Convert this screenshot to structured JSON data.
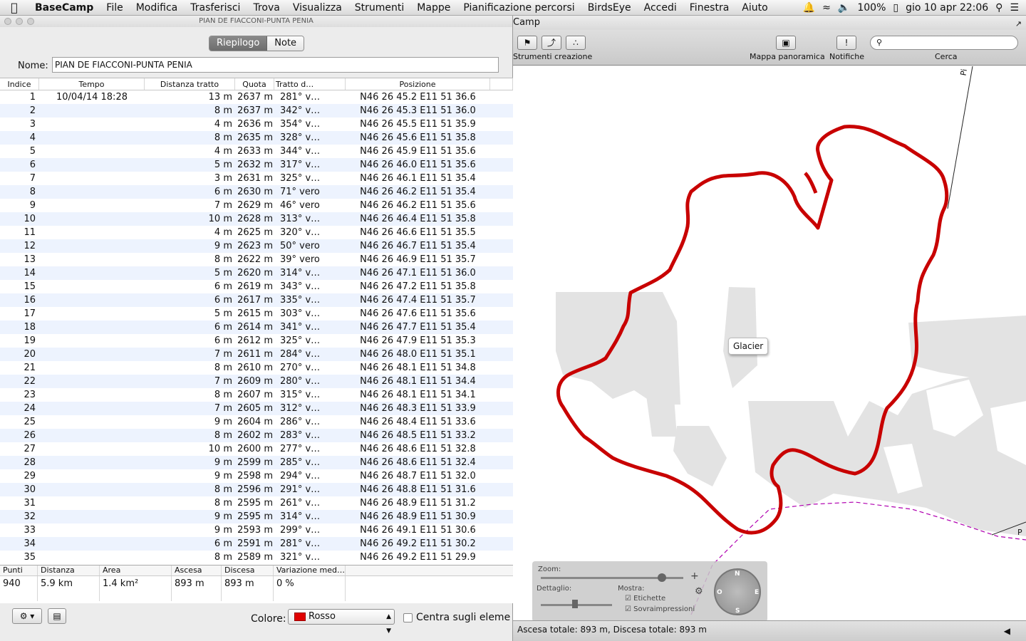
{
  "menubar": {
    "app": "BaseCamp",
    "items": [
      "File",
      "Modifica",
      "Trasferisci",
      "Trova",
      "Visualizza",
      "Strumenti",
      "Mappe",
      "Pianificazione percorsi",
      "BirdsEye",
      "Accedi",
      "Finestra",
      "Aiuto"
    ],
    "battery": "100%",
    "clock": "gio 10 apr  22:06"
  },
  "track_window": {
    "title": "PIAN DE FIACCONI-PUNTA PENIA",
    "tabs": [
      "Riepilogo",
      "Note"
    ],
    "nome_label": "Nome:",
    "nome_value": "PIAN DE FIACCONI-PUNTA PENIA",
    "columns": [
      "Indice",
      "Tempo",
      "Distanza tratto",
      "Quota",
      "Tratto d…",
      "Posizione"
    ],
    "rows": [
      [
        "1",
        "10/04/14 18:28",
        "13 m",
        "2637 m",
        "281° v…",
        "N46 26 45.2 E11 51 36.6"
      ],
      [
        "2",
        "",
        "8 m",
        "2637 m",
        "342° v…",
        "N46 26 45.3 E11 51 36.0"
      ],
      [
        "3",
        "",
        "4 m",
        "2636 m",
        "354° v…",
        "N46 26 45.5 E11 51 35.9"
      ],
      [
        "4",
        "",
        "8 m",
        "2635 m",
        "328° v…",
        "N46 26 45.6 E11 51 35.8"
      ],
      [
        "5",
        "",
        "4 m",
        "2633 m",
        "344° v…",
        "N46 26 45.9 E11 51 35.6"
      ],
      [
        "6",
        "",
        "5 m",
        "2632 m",
        "317° v…",
        "N46 26 46.0 E11 51 35.6"
      ],
      [
        "7",
        "",
        "3 m",
        "2631 m",
        "325° v…",
        "N46 26 46.1 E11 51 35.4"
      ],
      [
        "8",
        "",
        "6 m",
        "2630 m",
        "71° vero",
        "N46 26 46.2 E11 51 35.4"
      ],
      [
        "9",
        "",
        "7 m",
        "2629 m",
        "46° vero",
        "N46 26 46.2 E11 51 35.6"
      ],
      [
        "10",
        "",
        "10 m",
        "2628 m",
        "313° v…",
        "N46 26 46.4 E11 51 35.8"
      ],
      [
        "11",
        "",
        "4 m",
        "2625 m",
        "320° v…",
        "N46 26 46.6 E11 51 35.5"
      ],
      [
        "12",
        "",
        "9 m",
        "2623 m",
        "50° vero",
        "N46 26 46.7 E11 51 35.4"
      ],
      [
        "13",
        "",
        "8 m",
        "2622 m",
        "39° vero",
        "N46 26 46.9 E11 51 35.7"
      ],
      [
        "14",
        "",
        "5 m",
        "2620 m",
        "314° v…",
        "N46 26 47.1 E11 51 36.0"
      ],
      [
        "15",
        "",
        "6 m",
        "2619 m",
        "343° v…",
        "N46 26 47.2 E11 51 35.8"
      ],
      [
        "16",
        "",
        "6 m",
        "2617 m",
        "335° v…",
        "N46 26 47.4 E11 51 35.7"
      ],
      [
        "17",
        "",
        "5 m",
        "2615 m",
        "303° v…",
        "N46 26 47.6 E11 51 35.6"
      ],
      [
        "18",
        "",
        "6 m",
        "2614 m",
        "341° v…",
        "N46 26 47.7 E11 51 35.4"
      ],
      [
        "19",
        "",
        "6 m",
        "2612 m",
        "325° v…",
        "N46 26 47.9 E11 51 35.3"
      ],
      [
        "20",
        "",
        "7 m",
        "2611 m",
        "284° v…",
        "N46 26 48.0 E11 51 35.1"
      ],
      [
        "21",
        "",
        "8 m",
        "2610 m",
        "270° v…",
        "N46 26 48.1 E11 51 34.8"
      ],
      [
        "22",
        "",
        "7 m",
        "2609 m",
        "280° v…",
        "N46 26 48.1 E11 51 34.4"
      ],
      [
        "23",
        "",
        "8 m",
        "2607 m",
        "315° v…",
        "N46 26 48.1 E11 51 34.1"
      ],
      [
        "24",
        "",
        "7 m",
        "2605 m",
        "312° v…",
        "N46 26 48.3 E11 51 33.9"
      ],
      [
        "25",
        "",
        "9 m",
        "2604 m",
        "286° v…",
        "N46 26 48.4 E11 51 33.6"
      ],
      [
        "26",
        "",
        "8 m",
        "2602 m",
        "283° v…",
        "N46 26 48.5 E11 51 33.2"
      ],
      [
        "27",
        "",
        "10 m",
        "2600 m",
        "277° v…",
        "N46 26 48.6 E11 51 32.8"
      ],
      [
        "28",
        "",
        "9 m",
        "2599 m",
        "285° v…",
        "N46 26 48.6 E11 51 32.4"
      ],
      [
        "29",
        "",
        "9 m",
        "2598 m",
        "294° v…",
        "N46 26 48.7 E11 51 32.0"
      ],
      [
        "30",
        "",
        "8 m",
        "2596 m",
        "291° v…",
        "N46 26 48.8 E11 51 31.6"
      ],
      [
        "31",
        "",
        "8 m",
        "2595 m",
        "261° v…",
        "N46 26 48.9 E11 51 31.2"
      ],
      [
        "32",
        "",
        "9 m",
        "2595 m",
        "314° v…",
        "N46 26 48.9 E11 51 30.9"
      ],
      [
        "33",
        "",
        "9 m",
        "2593 m",
        "299° v…",
        "N46 26 49.1 E11 51 30.6"
      ],
      [
        "34",
        "",
        "6 m",
        "2591 m",
        "281° v…",
        "N46 26 49.2 E11 51 30.2"
      ],
      [
        "35",
        "",
        "8 m",
        "2589 m",
        "321° v…",
        "N46 26 49.2 E11 51 29.9"
      ]
    ],
    "summary_headers": [
      "Punti",
      "Distanza",
      "Area",
      "Ascesa",
      "Discesa",
      "Variazione med…"
    ],
    "summary_values": [
      "940",
      "5.9 km",
      "1.4 km²",
      "893 m",
      "893 m",
      "0 %"
    ],
    "colore_label": "Colore:",
    "colore_value": "Rosso",
    "centra_label": "Centra sugli eleme"
  },
  "map_window": {
    "title": "Camp",
    "tools_label": "Strumenti creazione",
    "panorama_label": "Mappa panoramica",
    "notifiche_label": "Notifiche",
    "cerca_label": "Cerca",
    "glacier_label": "Glacier",
    "hud_zoom": "Zoom:",
    "hud_dettaglio": "Dettaglio:",
    "hud_mostra": "Mostra:",
    "hud_etichette": "Etichette",
    "hud_sovra": "Sovraimpressioni",
    "compass": {
      "n": "N",
      "s": "S",
      "e": "E",
      "o": "O"
    },
    "status": "Ascesa totale: 893 m, Discesa totale: 893 m",
    "map_label_top": "Pi",
    "map_label_right": "P"
  },
  "colors": {
    "track": "#c80000",
    "terrain": "#e3e3e3",
    "accent_seg": "#777777"
  }
}
